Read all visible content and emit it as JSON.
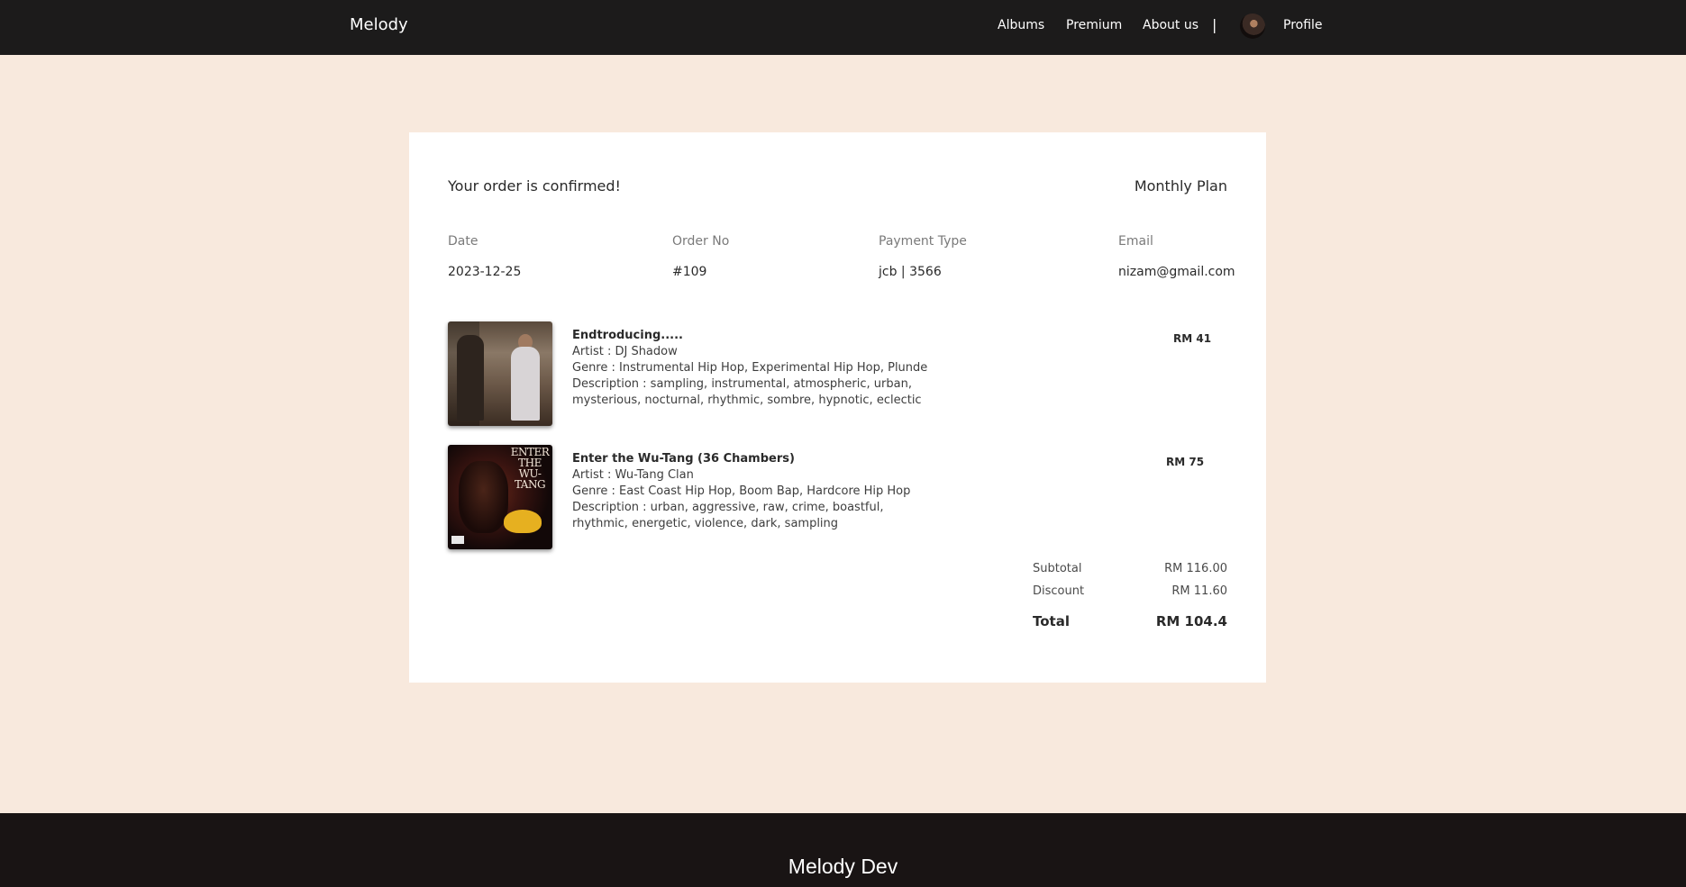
{
  "navbar": {
    "brand": "Melody",
    "links": {
      "albums": "Albums",
      "premium": "Premium",
      "about": "About us",
      "separator": "|",
      "profile": "Profile"
    }
  },
  "order": {
    "heading": "Your order is confirmed!",
    "plan": "Monthly Plan",
    "meta": {
      "date_label": "Date",
      "date_value": "2023-12-25",
      "order_label": "Order No",
      "order_value": "#109",
      "payment_label": "Payment Type",
      "payment_value": "jcb | 3566",
      "email_label": "Email",
      "email_value": "nizam@gmail.com"
    },
    "items": [
      {
        "title": "Endtroducing.....",
        "artist": "Artist : DJ Shadow",
        "genre": "Genre : Instrumental Hip Hop, Experimental Hip Hop, Plunde",
        "description_1": "Description : sampling, instrumental, atmospheric, urban,",
        "description_2": "mysterious, nocturnal, rhythmic, sombre, hypnotic, eclectic",
        "price": "RM 41"
      },
      {
        "title": "Enter the Wu-Tang (36 Chambers)",
        "artist": "Artist : Wu-Tang Clan",
        "genre": "Genre : East Coast Hip Hop, Boom Bap, Hardcore Hip Hop",
        "description_1": "Description : urban, aggressive, raw, crime, boastful,",
        "description_2": "rhythmic, energetic, violence, dark, sampling",
        "price": "RM 75",
        "cover_text": "ENTER THE WU-TANG"
      }
    ],
    "summary": {
      "subtotal_label": "Subtotal",
      "subtotal_value": "RM 116.00",
      "discount_label": "Discount",
      "discount_value": "RM 11.60",
      "total_label": "Total",
      "total_value": "RM 104.4"
    }
  },
  "footer": {
    "brand": "Melody Dev"
  }
}
